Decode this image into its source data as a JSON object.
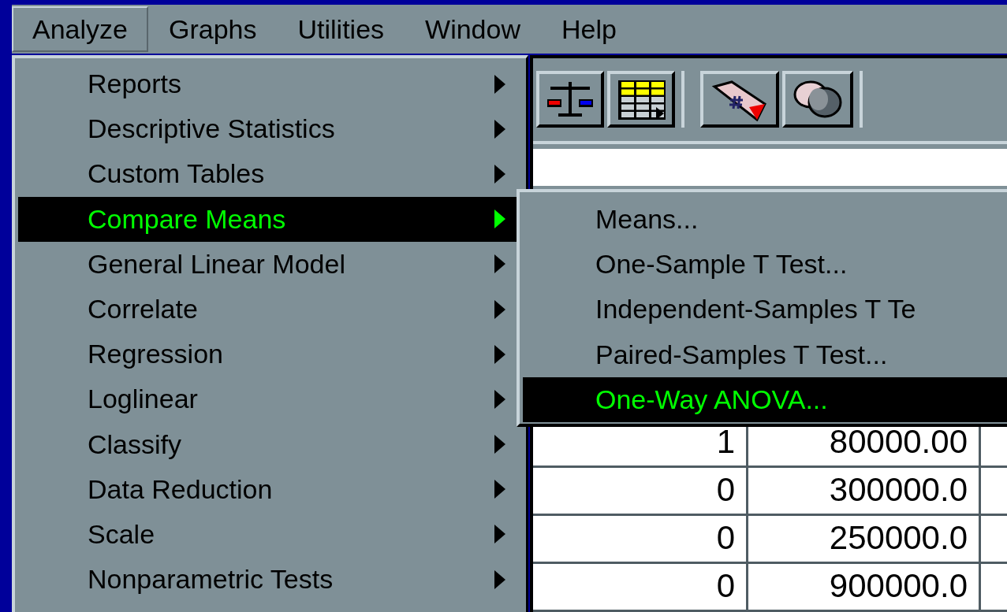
{
  "menubar": [
    {
      "label": "Analyze",
      "selected": true
    },
    {
      "label": "Graphs",
      "selected": false
    },
    {
      "label": "Utilities",
      "selected": false
    },
    {
      "label": "Window",
      "selected": false
    },
    {
      "label": "Help",
      "selected": false
    }
  ],
  "analyze_menu": [
    {
      "label": "Reports",
      "selected": false
    },
    {
      "label": "Descriptive Statistics",
      "selected": false
    },
    {
      "label": "Custom Tables",
      "selected": false
    },
    {
      "label": "Compare Means",
      "selected": true
    },
    {
      "label": "General Linear Model",
      "selected": false
    },
    {
      "label": "Correlate",
      "selected": false
    },
    {
      "label": "Regression",
      "selected": false
    },
    {
      "label": "Loglinear",
      "selected": false
    },
    {
      "label": "Classify",
      "selected": false
    },
    {
      "label": "Data Reduction",
      "selected": false
    },
    {
      "label": "Scale",
      "selected": false
    },
    {
      "label": "Nonparametric Tests",
      "selected": false
    }
  ],
  "compare_means_menu": [
    {
      "label": "Means...",
      "selected": false
    },
    {
      "label": "One-Sample T Test...",
      "selected": false
    },
    {
      "label": "Independent-Samples T Te",
      "selected": false
    },
    {
      "label": "Paired-Samples T Test...",
      "selected": false
    },
    {
      "label": "One-Way ANOVA...",
      "selected": true
    }
  ],
  "data_grid": {
    "rows": [
      [
        "1",
        "80000.00"
      ],
      [
        "0",
        "300000.0"
      ],
      [
        "0",
        "250000.0"
      ],
      [
        "0",
        "900000.0"
      ]
    ]
  }
}
